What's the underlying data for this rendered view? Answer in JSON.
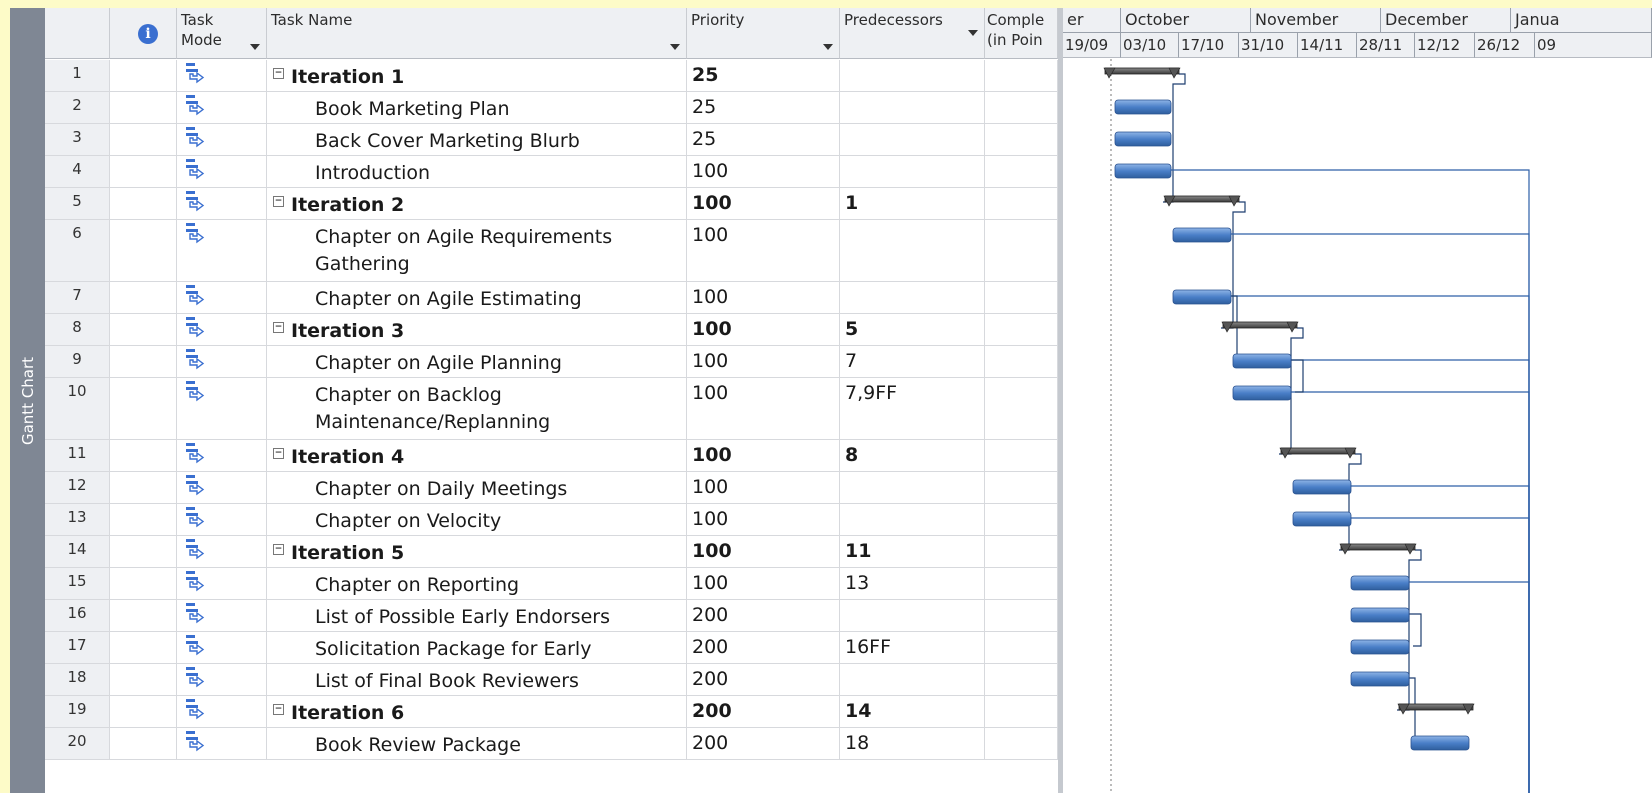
{
  "side_tab": {
    "label": "Gantt Chart"
  },
  "columns": {
    "info_icon": "info-icon",
    "task_mode": "Task Mode",
    "task_name": "Task Name",
    "priority": "Priority",
    "predecessors": "Predecessors",
    "completion": "Comple (in Poin"
  },
  "timescale": {
    "months": [
      "er",
      "October",
      "November",
      "December",
      "Janua"
    ],
    "weeks": [
      "19/09",
      "03/10",
      "17/10",
      "31/10",
      "14/11",
      "28/11",
      "12/12",
      "26/12",
      "09"
    ]
  },
  "tasks": [
    {
      "id": "1",
      "name": "Iteration 1",
      "priority": "25",
      "pred": "",
      "summary": true
    },
    {
      "id": "2",
      "name": "Book Marketing Plan",
      "priority": "25",
      "pred": "",
      "summary": false
    },
    {
      "id": "3",
      "name": "Back Cover Marketing Blurb",
      "priority": "25",
      "pred": "",
      "summary": false
    },
    {
      "id": "4",
      "name": "Introduction",
      "priority": "100",
      "pred": "",
      "summary": false
    },
    {
      "id": "5",
      "name": "Iteration 2",
      "priority": "100",
      "pred": "1",
      "summary": true
    },
    {
      "id": "6",
      "name": "Chapter on Agile Requirements Gathering",
      "priority": "100",
      "pred": "",
      "summary": false
    },
    {
      "id": "7",
      "name": "Chapter on Agile Estimating",
      "priority": "100",
      "pred": "",
      "summary": false
    },
    {
      "id": "8",
      "name": "Iteration 3",
      "priority": "100",
      "pred": "5",
      "summary": true
    },
    {
      "id": "9",
      "name": "Chapter on Agile Planning",
      "priority": "100",
      "pred": "7",
      "summary": false
    },
    {
      "id": "10",
      "name": "Chapter on Backlog Maintenance/Replanning",
      "priority": "100",
      "pred": "7,9FF",
      "summary": false
    },
    {
      "id": "11",
      "name": "Iteration 4",
      "priority": "100",
      "pred": "8",
      "summary": true
    },
    {
      "id": "12",
      "name": "Chapter on Daily Meetings",
      "priority": "100",
      "pred": "",
      "summary": false
    },
    {
      "id": "13",
      "name": "Chapter on Velocity",
      "priority": "100",
      "pred": "",
      "summary": false
    },
    {
      "id": "14",
      "name": "Iteration 5",
      "priority": "100",
      "pred": "11",
      "summary": true
    },
    {
      "id": "15",
      "name": "Chapter on Reporting",
      "priority": "100",
      "pred": "13",
      "summary": false
    },
    {
      "id": "16",
      "name": "List of Possible Early Endorsers",
      "priority": "200",
      "pred": "",
      "summary": false
    },
    {
      "id": "17",
      "name": "Solicitation Package for Early Endorsers",
      "priority": "200",
      "pred": "16FF",
      "summary": false
    },
    {
      "id": "18",
      "name": "List of Final Book Reviewers",
      "priority": "200",
      "pred": "",
      "summary": false
    },
    {
      "id": "19",
      "name": "Iteration 6",
      "priority": "200",
      "pred": "14",
      "summary": true
    },
    {
      "id": "20",
      "name": "Book Review Package",
      "priority": "200",
      "pred": "18",
      "summary": false
    }
  ],
  "colors": {
    "task_bar": "#4a7fc8",
    "summary_bar": "#4d4d4d",
    "link": "#2d5fa8",
    "background": "#fdfbc8"
  }
}
